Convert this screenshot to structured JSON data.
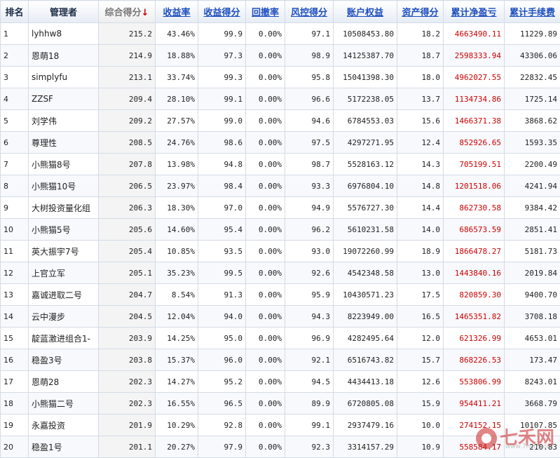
{
  "headers": {
    "rank": "排名",
    "manager": "管理者",
    "score": "综合得分",
    "score_arrow": "↓",
    "return_rate": "收益率",
    "return_score": "收益得分",
    "drawdown": "回撤率",
    "risk_score": "风控得分",
    "equity": "账户权益",
    "asset_score": "资产得分",
    "net_profit": "累计净盈亏",
    "fees": "累计手续费"
  },
  "rows": [
    {
      "rank": "1",
      "manager": "lyhhw8",
      "score": "215.2",
      "return_rate": "43.46%",
      "return_score": "99.9",
      "drawdown": "0.00%",
      "risk_score": "97.1",
      "equity": "10508453.80",
      "asset_score": "18.2",
      "net_profit": "4663490.11",
      "fees": "11229.89"
    },
    {
      "rank": "2",
      "manager": "恩萌18",
      "score": "214.9",
      "return_rate": "18.88%",
      "return_score": "97.3",
      "drawdown": "0.00%",
      "risk_score": "98.9",
      "equity": "14125387.70",
      "asset_score": "18.7",
      "net_profit": "2598333.94",
      "fees": "43306.06"
    },
    {
      "rank": "3",
      "manager": "simplyfu",
      "score": "213.1",
      "return_rate": "33.74%",
      "return_score": "99.3",
      "drawdown": "0.00%",
      "risk_score": "95.8",
      "equity": "15041398.30",
      "asset_score": "18.0",
      "net_profit": "4962027.55",
      "fees": "22832.45"
    },
    {
      "rank": "4",
      "manager": "ZZSF",
      "score": "209.4",
      "return_rate": "28.10%",
      "return_score": "99.1",
      "drawdown": "0.00%",
      "risk_score": "96.6",
      "equity": "5172238.05",
      "asset_score": "13.7",
      "net_profit": "1134734.86",
      "fees": "1725.14"
    },
    {
      "rank": "5",
      "manager": "刘学伟",
      "score": "209.2",
      "return_rate": "27.57%",
      "return_score": "99.0",
      "drawdown": "0.00%",
      "risk_score": "94.6",
      "equity": "6784553.03",
      "asset_score": "15.6",
      "net_profit": "1466371.38",
      "fees": "3868.62"
    },
    {
      "rank": "6",
      "manager": "尊理性",
      "score": "208.5",
      "return_rate": "24.76%",
      "return_score": "98.6",
      "drawdown": "0.00%",
      "risk_score": "97.5",
      "equity": "4297271.95",
      "asset_score": "12.4",
      "net_profit": "852926.65",
      "fees": "1593.35"
    },
    {
      "rank": "7",
      "manager": "小熊猫8号",
      "score": "207.8",
      "return_rate": "13.98%",
      "return_score": "94.8",
      "drawdown": "0.00%",
      "risk_score": "98.7",
      "equity": "5528163.12",
      "asset_score": "14.3",
      "net_profit": "705199.51",
      "fees": "2200.49"
    },
    {
      "rank": "8",
      "manager": "小熊猫10号",
      "score": "206.5",
      "return_rate": "23.97%",
      "return_score": "98.4",
      "drawdown": "0.00%",
      "risk_score": "93.3",
      "equity": "6976804.10",
      "asset_score": "14.8",
      "net_profit": "1201518.06",
      "fees": "4241.94"
    },
    {
      "rank": "9",
      "manager": "大树投资量化组",
      "score": "206.3",
      "return_rate": "18.30%",
      "return_score": "97.0",
      "drawdown": "0.00%",
      "risk_score": "94.9",
      "equity": "5576727.30",
      "asset_score": "14.4",
      "net_profit": "862730.58",
      "fees": "9384.42"
    },
    {
      "rank": "10",
      "manager": "小熊猫5号",
      "score": "205.6",
      "return_rate": "14.60%",
      "return_score": "95.4",
      "drawdown": "0.00%",
      "risk_score": "96.2",
      "equity": "5610231.58",
      "asset_score": "14.0",
      "net_profit": "686573.59",
      "fees": "2851.41"
    },
    {
      "rank": "11",
      "manager": "英大振宇7号",
      "score": "205.4",
      "return_rate": "10.85%",
      "return_score": "93.5",
      "drawdown": "0.00%",
      "risk_score": "93.0",
      "equity": "19072260.99",
      "asset_score": "18.9",
      "net_profit": "1866478.27",
      "fees": "5181.73"
    },
    {
      "rank": "12",
      "manager": "上官立军",
      "score": "205.1",
      "return_rate": "35.23%",
      "return_score": "99.5",
      "drawdown": "0.00%",
      "risk_score": "92.6",
      "equity": "4542348.58",
      "asset_score": "13.0",
      "net_profit": "1443840.16",
      "fees": "2019.84"
    },
    {
      "rank": "13",
      "manager": "嘉诚进取二号",
      "score": "204.7",
      "return_rate": "8.54%",
      "return_score": "91.3",
      "drawdown": "0.00%",
      "risk_score": "95.9",
      "equity": "10430571.23",
      "asset_score": "17.5",
      "net_profit": "820859.30",
      "fees": "9400.70"
    },
    {
      "rank": "14",
      "manager": "云中漫步",
      "score": "204.5",
      "return_rate": "12.04%",
      "return_score": "94.0",
      "drawdown": "0.00%",
      "risk_score": "94.3",
      "equity": "8223949.00",
      "asset_score": "16.5",
      "net_profit": "1465351.82",
      "fees": "3708.18"
    },
    {
      "rank": "15",
      "manager": "靛蓝激进组合1-",
      "score": "203.9",
      "return_rate": "14.25%",
      "return_score": "95.0",
      "drawdown": "0.00%",
      "risk_score": "96.9",
      "equity": "4282495.64",
      "asset_score": "12.0",
      "net_profit": "621326.99",
      "fees": "4653.01"
    },
    {
      "rank": "16",
      "manager": "稳盈3号",
      "score": "203.8",
      "return_rate": "15.37%",
      "return_score": "96.0",
      "drawdown": "0.00%",
      "risk_score": "92.1",
      "equity": "6516743.82",
      "asset_score": "15.7",
      "net_profit": "868226.53",
      "fees": "173.47"
    },
    {
      "rank": "17",
      "manager": "恩萌28",
      "score": "202.3",
      "return_rate": "14.27%",
      "return_score": "95.2",
      "drawdown": "0.00%",
      "risk_score": "94.5",
      "equity": "4434413.18",
      "asset_score": "12.6",
      "net_profit": "553806.99",
      "fees": "8243.01"
    },
    {
      "rank": "18",
      "manager": "小熊猫二号",
      "score": "202.3",
      "return_rate": "16.55%",
      "return_score": "96.5",
      "drawdown": "0.00%",
      "risk_score": "89.9",
      "equity": "6720805.08",
      "asset_score": "15.9",
      "net_profit": "954411.21",
      "fees": "3668.79"
    },
    {
      "rank": "19",
      "manager": "永嘉投资",
      "score": "201.9",
      "return_rate": "10.29%",
      "return_score": "92.8",
      "drawdown": "0.00%",
      "risk_score": "99.1",
      "equity": "2937479.16",
      "asset_score": "10.0",
      "net_profit": "274152.15",
      "fees": "10107.85"
    },
    {
      "rank": "20",
      "manager": "稳盈1号",
      "score": "201.1",
      "return_rate": "20.27%",
      "return_score": "97.9",
      "drawdown": "0.00%",
      "risk_score": "92.3",
      "equity": "3314157.29",
      "asset_score": "10.9",
      "net_profit": "558584.17",
      "fees": "210.83"
    }
  ],
  "watermark": {
    "text": "七禾网",
    "sub": "www.7hcn.com"
  },
  "colors": {
    "link": "#1f4fbf",
    "profit": "#cc0000",
    "header_bg": "#e6ecf5",
    "border": "#d4dbe6"
  }
}
